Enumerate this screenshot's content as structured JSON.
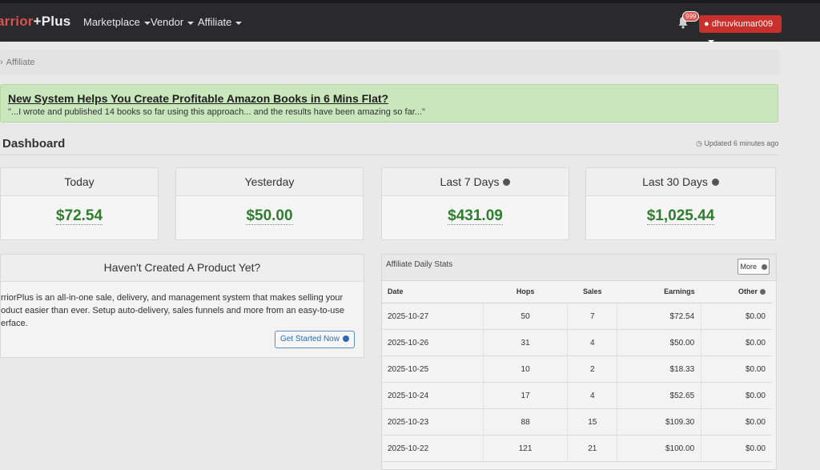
{
  "nav": {
    "brand_left": "arrior",
    "brand_plus": "+Plus",
    "items": [
      {
        "label": "Marketplace"
      },
      {
        "label": "Vendor"
      },
      {
        "label": "Affiliate"
      }
    ],
    "notification_count": "999",
    "username": "dhruvkumar009"
  },
  "breadcrumb": {
    "current": "Affiliate"
  },
  "promo": {
    "title": "New System Helps You Create Profitable Amazon Books in 6 Mins Flat?",
    "quote": "\"...I wrote and published 14 books so far using this approach... and the results have been amazing so far...\""
  },
  "dashboard": {
    "title": "Dashboard",
    "updated": "Updated 6 minutes ago"
  },
  "stats": [
    {
      "label": "Today",
      "value": "$72.54"
    },
    {
      "label": "Yesterday",
      "value": "$50.00"
    },
    {
      "label": "Last 7 Days",
      "value": "$431.09"
    },
    {
      "label": "Last 30 Days",
      "value": "$1,025.44"
    }
  ],
  "product_panel": {
    "title": "Haven't Created A Product Yet?",
    "line1": "rriorPlus is an all-in-one sale, delivery, and management system that makes selling your",
    "line2": "oduct easier than ever. Setup auto-delivery, sales funnels and more from an easy-to-use",
    "line3": "erface.",
    "button": "Get Started Now"
  },
  "affiliate_stats": {
    "title": "Affiliate Daily Stats",
    "more": "More",
    "columns": [
      "Date",
      "Hops",
      "Sales",
      "Earnings",
      "Other"
    ],
    "rows": [
      {
        "date": "2025-10-27",
        "hops": "50",
        "sales": "7",
        "earnings": "$72.54",
        "other": "$0.00"
      },
      {
        "date": "2025-10-26",
        "hops": "31",
        "sales": "4",
        "earnings": "$50.00",
        "other": "$0.00"
      },
      {
        "date": "2025-10-25",
        "hops": "10",
        "sales": "2",
        "earnings": "$18.33",
        "other": "$0.00"
      },
      {
        "date": "2025-10-24",
        "hops": "17",
        "sales": "4",
        "earnings": "$52.65",
        "other": "$0.00"
      },
      {
        "date": "2025-10-23",
        "hops": "88",
        "sales": "15",
        "earnings": "$109.30",
        "other": "$0.00"
      },
      {
        "date": "2025-10-22",
        "hops": "121",
        "sales": "21",
        "earnings": "$100.00",
        "other": "$0.00"
      }
    ]
  },
  "colors": {
    "nav_bg": "#2a2a2c",
    "brand_red": "#d9534f",
    "user_button": "#c9302c",
    "promo_bg": "#c9e6bd",
    "money_green": "#2f7d2f",
    "link_blue": "#2a6cb3"
  }
}
